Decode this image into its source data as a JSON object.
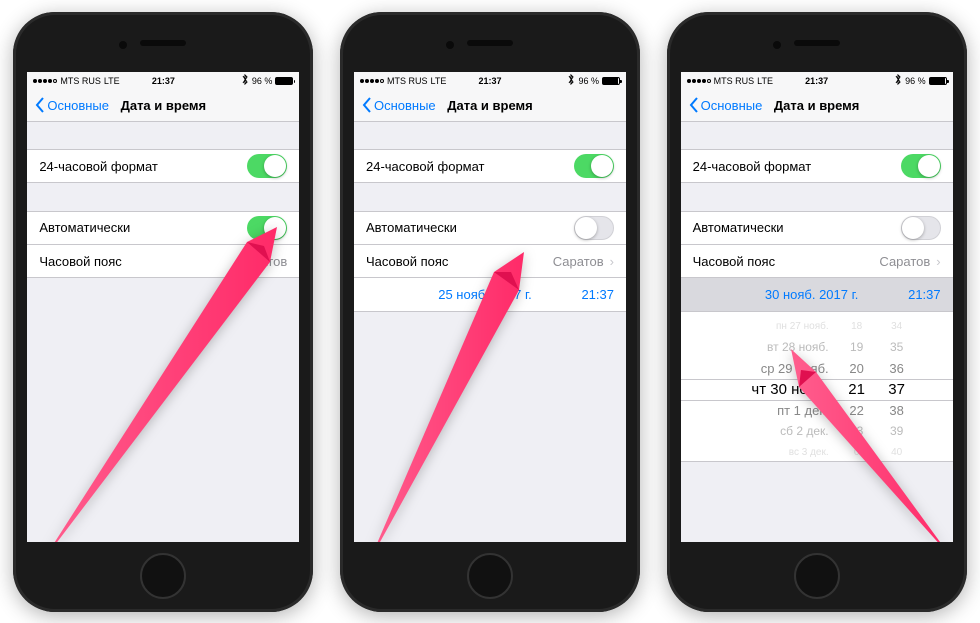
{
  "statusbar": {
    "carrier": "MTS RUS",
    "network": "LTE",
    "time": "21:37",
    "battery": "96 %"
  },
  "nav": {
    "back": "Основные",
    "title": "Дата и время"
  },
  "labels": {
    "format24": "24-часовой формат",
    "auto": "Автоматически",
    "timezone": "Часовой пояс",
    "tz_value": "Саратов"
  },
  "phones": [
    {
      "auto_on": true
    },
    {
      "auto_on": false,
      "date": "25 нояб. 2017 г.",
      "time": "21:37",
      "selected": false
    },
    {
      "auto_on": false,
      "date": "30 нояб. 2017 г.",
      "time": "21:37",
      "selected": true,
      "picker": true
    }
  ],
  "picker": {
    "dates": [
      "пн 27 нояб.",
      "вт 28 нояб.",
      "ср 29 нояб.",
      "чт 30 нояб.",
      "пт 1 дек.",
      "сб 2 дек.",
      "вс 3 дек."
    ],
    "hours": [
      "18",
      "19",
      "20",
      "21",
      "22",
      "23",
      "0"
    ],
    "mins": [
      "34",
      "35",
      "36",
      "37",
      "38",
      "39",
      "40"
    ]
  },
  "arrow_color": "#ff2a68"
}
